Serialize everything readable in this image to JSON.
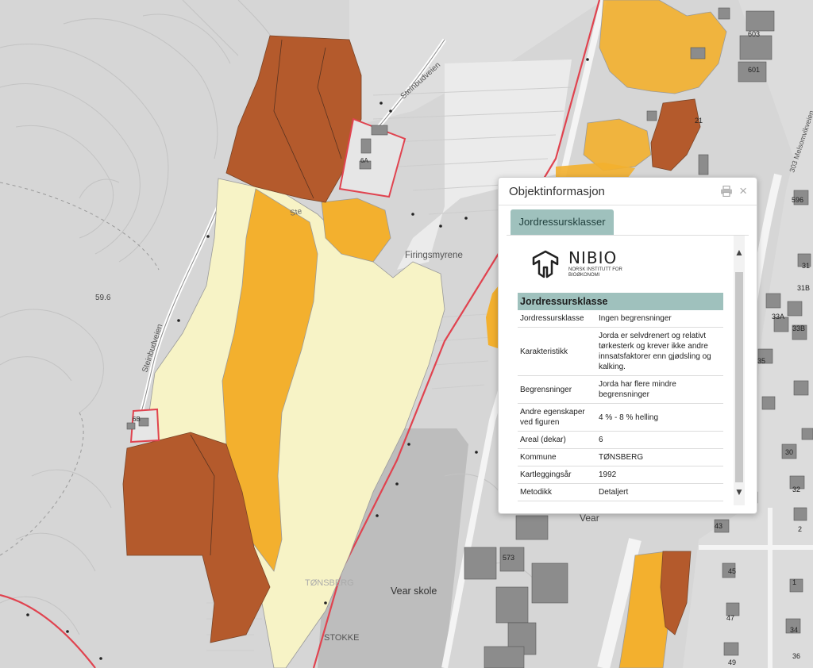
{
  "map": {
    "labels": {
      "road_steinbudveien_top": "Steinbudveien",
      "road_steinbudveien_left": "Steinbudveien",
      "road_ste_partial": "Ste",
      "road_melsomvik": "303 Melsomvikveien",
      "place_firingsmyrene": "Firingsmyrene",
      "elevation": "59.6",
      "municipality_tonsberg": "TØNSBERG",
      "municipality_stokke": "STOKKE",
      "school": "Vear skole",
      "place_vear": "Vear",
      "house_6a": "6A",
      "house_6b": "6B",
      "house_603": "603",
      "house_601": "601",
      "house_573": "573",
      "house_31": "31",
      "house_31b": "31B",
      "house_33a": "33A",
      "house_33b": "33B",
      "house_35": "35",
      "house_30": "30",
      "house_32": "32",
      "house_2": "2",
      "house_43": "43",
      "house_45": "45",
      "house_47": "47",
      "house_1": "1",
      "house_34": "34",
      "house_36": "36",
      "house_49": "49",
      "house_596": "596",
      "house_21": "21"
    },
    "colors": {
      "background": "#d6d6d6",
      "light_field": "#f7f3c6",
      "medium_orange": "#f3b02e",
      "dark_brown": "#b45a2c",
      "property_outline": "#e0434f",
      "road": "#f2f2f2"
    }
  },
  "popup": {
    "title": "Objektinformasjon",
    "print_icon": "printer-icon",
    "close_symbol": "×",
    "tab_label": "Jordressursklasser",
    "logo": {
      "name": "NIBIO",
      "subtitle": "NORSK INSTITUTT FOR BIOØKONOMI"
    },
    "table": {
      "header": "Jordressursklasse",
      "rows": [
        {
          "key": "Jordressursklasse",
          "value": "Ingen begrensninger"
        },
        {
          "key": "Karakteristikk",
          "value": "Jorda er selvdrenert og relativt tørkesterk og krever ikke andre innsatsfaktorer enn gjødsling og kalking."
        },
        {
          "key": "Begrensninger",
          "value": "Jorda har flere mindre begrensninger"
        },
        {
          "key": "Andre egenskaper ved figuren",
          "value": "4 % - 8 % helling"
        },
        {
          "key": "Areal (dekar)",
          "value": "6"
        },
        {
          "key": "Kommune",
          "value": "TØNSBERG"
        },
        {
          "key": "Kartleggingsår",
          "value": "1992"
        },
        {
          "key": "Metodikk",
          "value": "Detaljert"
        }
      ]
    }
  }
}
